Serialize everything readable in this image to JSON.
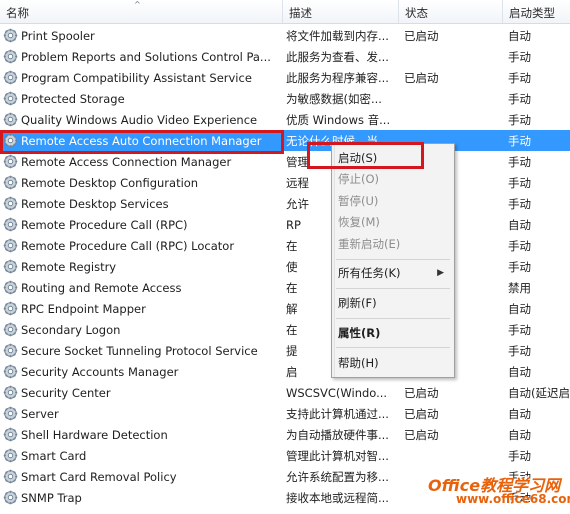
{
  "columns": {
    "name": "名称",
    "desc": "描述",
    "status": "状态",
    "start": "启动类型"
  },
  "services": [
    {
      "name": "Print Spooler",
      "desc": "将文件加载到内存...",
      "status": "已启动",
      "start": "自动"
    },
    {
      "name": "Problem Reports and Solutions Control Pa...",
      "desc": "此服务为查看、发...",
      "status": "",
      "start": "手动"
    },
    {
      "name": "Program Compatibility Assistant Service",
      "desc": "此服务为程序兼容...",
      "status": "已启动",
      "start": "手动"
    },
    {
      "name": "Protected Storage",
      "desc": "为敏感数据(如密...",
      "status": "",
      "start": "手动"
    },
    {
      "name": "Quality Windows Audio Video Experience",
      "desc": "优质 Windows 音...",
      "status": "",
      "start": "手动"
    },
    {
      "name": "Remote Access Auto Connection Manager",
      "desc": "无论什么时候，当...",
      "status": "",
      "start": "手动"
    },
    {
      "name": "Remote Access Connection Manager",
      "desc": "管理",
      "status": "",
      "start": "手动"
    },
    {
      "name": "Remote Desktop Configuration",
      "desc": "远程",
      "status": "",
      "start": "手动"
    },
    {
      "name": "Remote Desktop Services",
      "desc": "允许",
      "status": "",
      "start": "手动"
    },
    {
      "name": "Remote Procedure Call (RPC)",
      "desc": "RP",
      "status": "",
      "start": "自动"
    },
    {
      "name": "Remote Procedure Call (RPC) Locator",
      "desc": "在",
      "status": "",
      "start": "手动"
    },
    {
      "name": "Remote Registry",
      "desc": "使",
      "status": "",
      "start": "手动"
    },
    {
      "name": "Routing and Remote Access",
      "desc": "在",
      "status": "",
      "start": "禁用"
    },
    {
      "name": "RPC Endpoint Mapper",
      "desc": "解",
      "status": "",
      "start": "自动"
    },
    {
      "name": "Secondary Logon",
      "desc": "在",
      "status": "",
      "start": "手动"
    },
    {
      "name": "Secure Socket Tunneling Protocol Service",
      "desc": "提",
      "status": "",
      "start": "手动"
    },
    {
      "name": "Security Accounts Manager",
      "desc": "启",
      "status": "",
      "start": "自动"
    },
    {
      "name": "Security Center",
      "desc": "WSCSVC(Windo...",
      "status": "已启动",
      "start": "自动(延迟启"
    },
    {
      "name": "Server",
      "desc": "支持此计算机通过...",
      "status": "已启动",
      "start": "自动"
    },
    {
      "name": "Shell Hardware Detection",
      "desc": "为自动播放硬件事...",
      "status": "已启动",
      "start": "自动"
    },
    {
      "name": "Smart Card",
      "desc": "管理此计算机对智...",
      "status": "",
      "start": "手动"
    },
    {
      "name": "Smart Card Removal Policy",
      "desc": "允许系统配置为移...",
      "status": "",
      "start": "手动"
    },
    {
      "name": "SNMP Trap",
      "desc": "接收本地或远程简...",
      "status": "",
      "start": "手动"
    }
  ],
  "selected_index": 5,
  "context_menu": {
    "start": "启动(S)",
    "stop": "停止(O)",
    "pause": "暂停(U)",
    "resume": "恢复(M)",
    "restart": "重新启动(E)",
    "all_tasks": "所有任务(K)",
    "refresh": "刷新(F)",
    "properties": "属性(R)",
    "help": "帮助(H)"
  },
  "watermark": {
    "line1": "Office教程学习网",
    "line2": "www.office68.com"
  },
  "colors": {
    "selection": "#3399ff",
    "highlight_box": "#d3171e",
    "watermark": "#e8620c"
  }
}
